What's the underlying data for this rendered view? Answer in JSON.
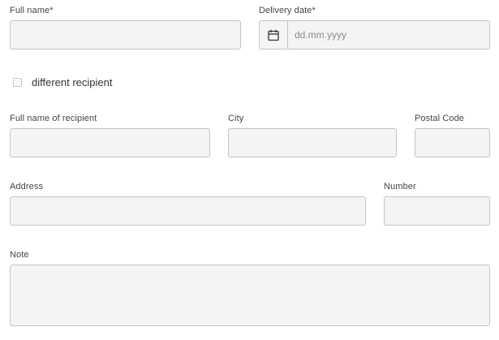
{
  "form": {
    "full_name": {
      "label": "Full name*",
      "value": ""
    },
    "delivery_date": {
      "label": "Delivery date*",
      "placeholder": "dd.mm.yyyy",
      "value": "",
      "icon": "calendar-icon"
    },
    "different_recipient": {
      "label": "different recipient",
      "checked": false
    },
    "recipient_name": {
      "label": "Full name of recipient",
      "value": ""
    },
    "city": {
      "label": "City",
      "value": ""
    },
    "postal_code": {
      "label": "Postal Code",
      "value": ""
    },
    "address": {
      "label": "Address",
      "value": ""
    },
    "number": {
      "label": "Number",
      "value": ""
    },
    "note": {
      "label": "Note",
      "value": ""
    }
  },
  "colors": {
    "field_background": "#f4f4f4",
    "field_border": "#c4c4c4",
    "label_text": "#444444",
    "placeholder_text": "#8a8a8a"
  }
}
